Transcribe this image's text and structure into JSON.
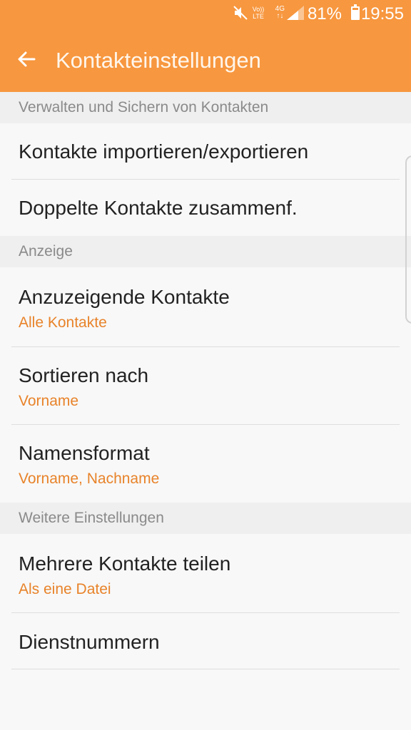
{
  "status_bar": {
    "volte": "Vo)) LTE",
    "network": "4G",
    "battery_percent": "81%",
    "battery_level": 0.81,
    "time": "19:55",
    "icons": [
      "mute-icon",
      "volte-icon",
      "network-4g-icon",
      "signal-icon",
      "battery-icon"
    ]
  },
  "app_bar": {
    "title": "Kontakteinstellungen",
    "back_icon": "arrow-left-icon"
  },
  "sections": [
    {
      "header": "Verwalten und Sichern von Kontakten",
      "items": [
        {
          "title": "Kontakte importieren/exportieren"
        },
        {
          "title": "Doppelte Kontakte zusammenf."
        }
      ]
    },
    {
      "header": "Anzeige",
      "items": [
        {
          "title": "Anzuzeigende Kontakte",
          "value": "Alle Kontakte"
        },
        {
          "title": "Sortieren nach",
          "value": "Vorname"
        },
        {
          "title": "Namensformat",
          "value": "Vorname, Nachname"
        }
      ]
    },
    {
      "header": "Weitere Einstellungen",
      "items": [
        {
          "title": "Mehrere Kontakte teilen",
          "value": "Als eine Datei"
        },
        {
          "title": "Dienstnummern"
        }
      ]
    }
  ],
  "colors": {
    "accent": "#f7973f",
    "secondary_text": "#e8832a",
    "section_header_bg": "#efefef"
  }
}
